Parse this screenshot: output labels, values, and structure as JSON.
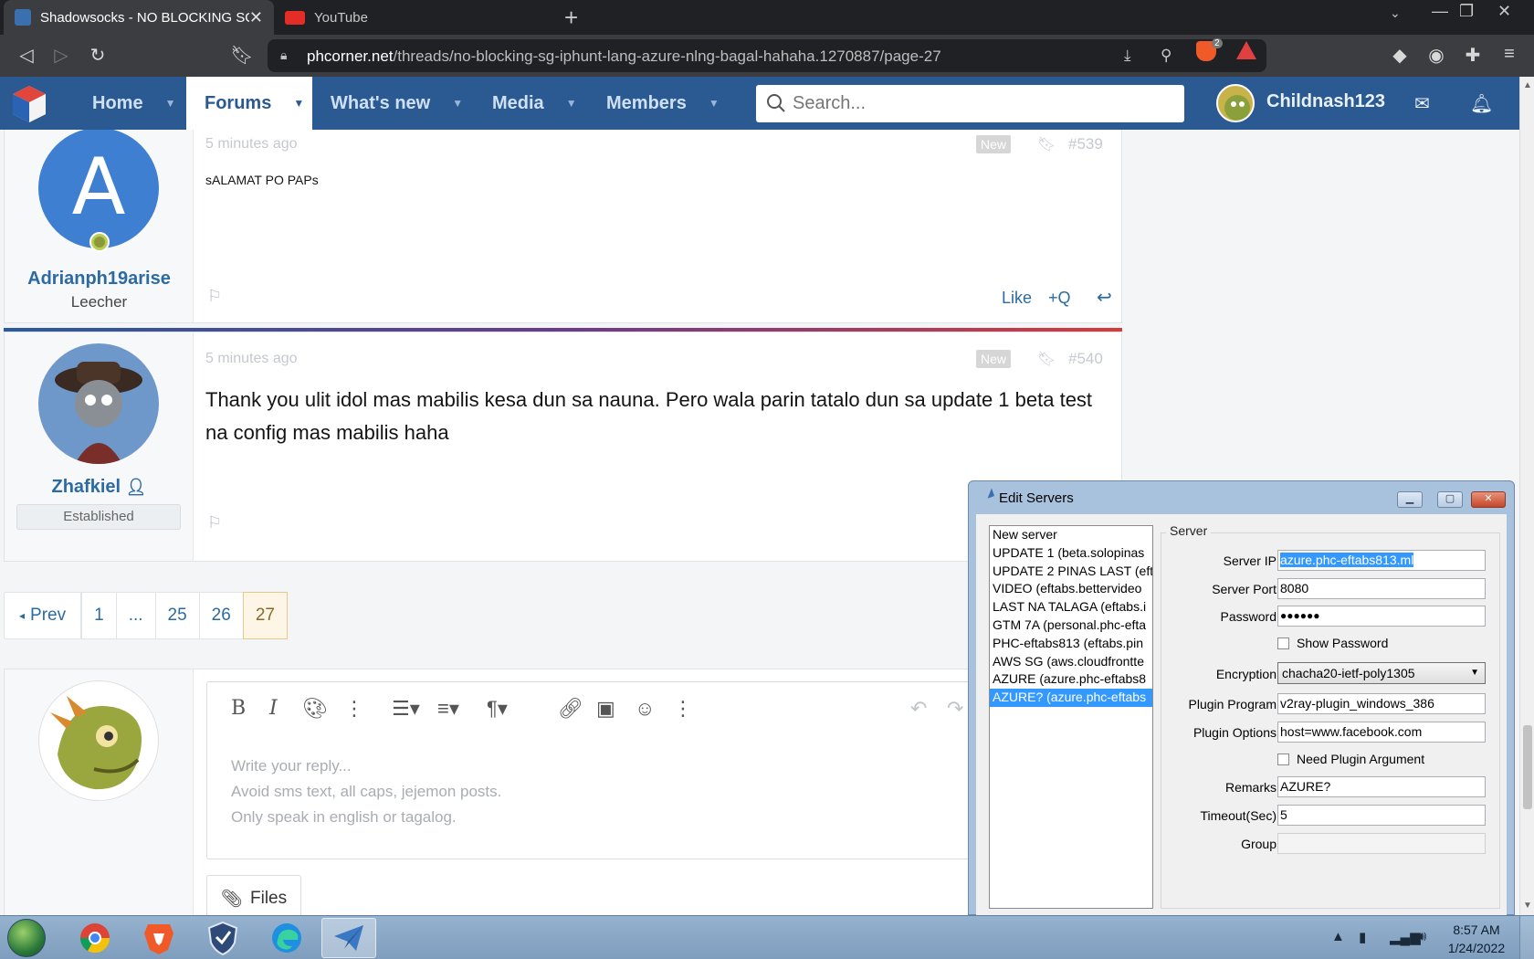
{
  "browser": {
    "tabs": [
      {
        "title": "Shadowsocks - NO BLOCKING SG",
        "active": true
      },
      {
        "title": "YouTube",
        "active": false
      }
    ],
    "url_domain": "phcorner.net",
    "url_path": "/threads/no-blocking-sg-iphunt-lang-azure-nlng-bagal-hahaha.1270887/page-27",
    "shield_count": "2"
  },
  "site": {
    "nav": {
      "home": "Home",
      "forums": "Forums",
      "whats_new": "What's new",
      "media": "Media",
      "members": "Members"
    },
    "search_placeholder": "Search...",
    "username": "Childnash123",
    "brand_color": "#2b5a93"
  },
  "posts": [
    {
      "avatar_letter": "A",
      "author": "Adrianph19arise",
      "user_title": "Leecher",
      "time": "5 minutes ago",
      "badge": "New",
      "number": "#539",
      "message": "sALAMAT PO PAPs",
      "actions": {
        "like": "Like",
        "quote": "+Q"
      }
    },
    {
      "author": "Zhafkiel",
      "user_title": "Established",
      "time": "5 minutes ago",
      "badge": "New",
      "number": "#540",
      "message": "Thank you ulit idol mas mabilis kesa dun sa nauna. Pero wala parin tatalo dun sa update 1 beta test na config mas mabilis haha"
    }
  ],
  "pagination": {
    "prev": "Prev",
    "pages": [
      "1",
      "...",
      "25",
      "26",
      "27"
    ],
    "current": "27"
  },
  "reply": {
    "placeholder_lines": [
      "Write your reply...",
      "Avoid sms text, all caps, jejemon posts.",
      "Only speak in english or tagalog."
    ],
    "files_label": "Files"
  },
  "dialog": {
    "title": "Edit Servers",
    "servers": [
      "New server",
      "UPDATE 1 (beta.solopinas",
      "UPDATE 2 PINAS LAST (eft",
      "VIDEO (eftabs.bettervideo",
      "LAST NA TALAGA (eftabs.i",
      "GTM 7A (personal.phc-efta",
      "PHC-eftabs813 (eftabs.pin",
      "AWS SG (aws.cloudfrontte",
      "AZURE (azure.phc-eftabs8",
      "AZURE? (azure.phc-eftabs"
    ],
    "selected_server": "AZURE? (azure.phc-eftabs",
    "group_label": "Server",
    "labels": {
      "server_ip": "Server IP",
      "server_port": "Server Port",
      "password": "Password",
      "show_password": "Show Password",
      "encryption": "Encryption",
      "plugin_program": "Plugin Program",
      "plugin_options": "Plugin Options",
      "need_plugin_argument": "Need Plugin Argument",
      "remarks": "Remarks",
      "timeout": "Timeout(Sec)",
      "group": "Group"
    },
    "values": {
      "server_ip": "azure.phc-eftabs813.ml",
      "server_port": "8080",
      "password": "●●●●●●",
      "show_password_checked": false,
      "encryption": "chacha20-ietf-poly1305",
      "plugin_program": "v2ray-plugin_windows_386",
      "plugin_options": "host=www.facebook.com",
      "need_plugin_argument_checked": false,
      "remarks": "AZURE?",
      "timeout": "5",
      "group": ""
    }
  },
  "taskbar": {
    "time": "8:57 AM",
    "date": "1/24/2022"
  }
}
